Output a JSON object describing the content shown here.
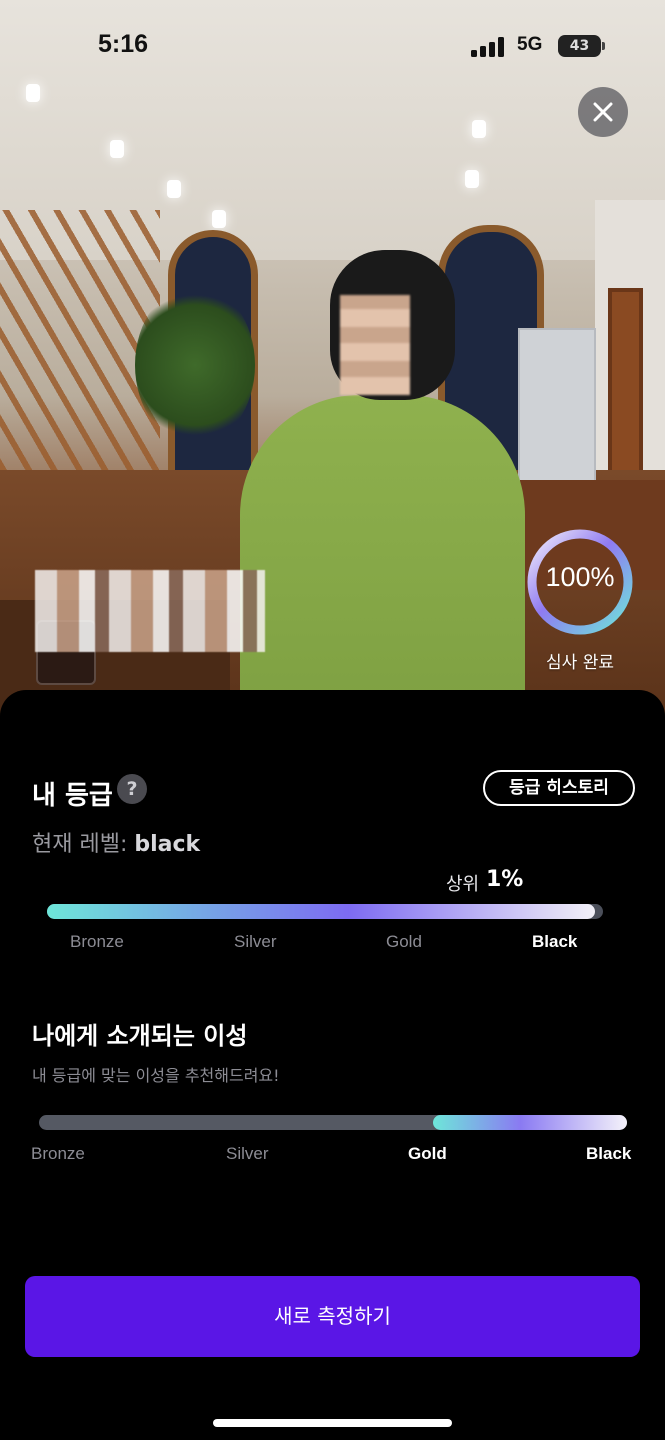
{
  "status_bar": {
    "time": "5:16",
    "network": "5G",
    "battery": "43"
  },
  "photo": {
    "progress_percent": 100,
    "progress_label": "100%",
    "progress_caption": "심사 완료"
  },
  "grade": {
    "title": "내 등급",
    "help_icon": "?",
    "history_button": "등급 히스토리",
    "current_level_prefix": "현재 레벨: ",
    "current_level": "black",
    "rank_label": "상위",
    "rank_value": "1%",
    "bar_fill_fraction": 0.985,
    "tiers": [
      "Bronze",
      "Silver",
      "Gold",
      "Black"
    ],
    "active_tier": "Black"
  },
  "matches": {
    "title": "나에게 소개되는 이성",
    "subtitle": "내 등급에 맞는 이성을 추천해드려요!",
    "range_start_fraction": 0.67,
    "range_end_fraction": 1.0,
    "tiers": [
      "Bronze",
      "Silver",
      "Gold",
      "Black"
    ],
    "active_tiers": [
      "Gold",
      "Black"
    ]
  },
  "actions": {
    "measure_button": "새로 측정하기"
  },
  "colors": {
    "accent": "#5a16e6",
    "gradient_start": "#6ee6d9",
    "gradient_mid": "#7d6bf2",
    "gradient_end": "#f2f0f7"
  }
}
